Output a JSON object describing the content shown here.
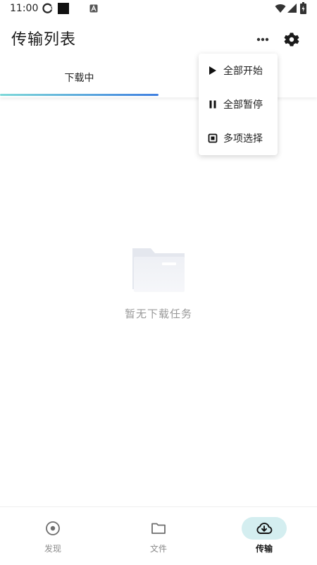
{
  "status_bar": {
    "time": "11:00"
  },
  "app_bar": {
    "title": "传输列表"
  },
  "tabs": [
    {
      "label": "下载中",
      "active": true
    },
    {
      "label": "",
      "active": false
    }
  ],
  "menu": {
    "items": [
      {
        "label": "全部开始",
        "icon": "play-icon"
      },
      {
        "label": "全部暂停",
        "icon": "pause-icon"
      },
      {
        "label": "多项选择",
        "icon": "select-icon"
      }
    ]
  },
  "empty_state": {
    "text": "暂无下载任务",
    "icon": "folder-icon"
  },
  "bottom_nav": {
    "items": [
      {
        "label": "发现",
        "icon": "discover-icon",
        "active": false
      },
      {
        "label": "文件",
        "icon": "folder-icon",
        "active": false
      },
      {
        "label": "传输",
        "icon": "cloud-download-icon",
        "active": true
      }
    ]
  },
  "colors": {
    "accent_gradient_start": "#7fd9d9",
    "accent_gradient_end": "#3f7fe0",
    "active_pill": "#d4eef0",
    "text_primary": "#1f1f1f",
    "text_muted": "#9a9a9a"
  }
}
